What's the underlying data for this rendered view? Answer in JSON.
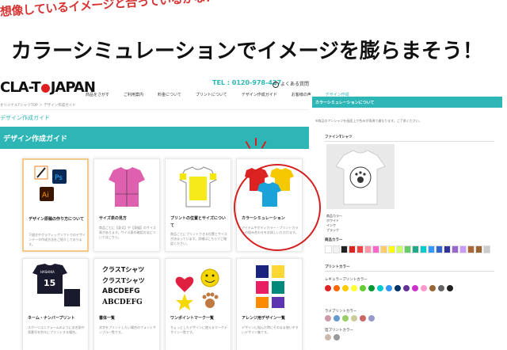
{
  "caption": {
    "sub": "想像しているイメージと合っているかな？",
    "headline": "カラーシミュレーションでイメージを膨らまそう！"
  },
  "header": {
    "logo_left": "CLA-T",
    "logo_right": "JAPAN",
    "tel": "TEL : 0120-978-427",
    "faq": "よくある質問",
    "nav": [
      "商品をさがす",
      "ご利用案内",
      "料金について",
      "プリントについて",
      "デザイン作成ガイド",
      "お客様の声",
      "デザイン作成"
    ]
  },
  "breadcrumb": "オリジナルTシャツTOP ＞ デザイン作成ガイド",
  "page_title": "デザイン作成ガイド",
  "banner_title": "デザイン作成ガイド",
  "cards": [
    {
      "title": "デザイン原稿の作り方について",
      "desc": "下描きやグラフィックソフトでのデザインデータ作成方法をご紹介しております。"
    },
    {
      "title": "サイズ表の見方",
      "desc": "商品ごとに【身丈】や【身幅】のサイズ表があります。サイズ表の確認方法についてはこちら。"
    },
    {
      "title": "プリントの位置とサイズについて",
      "desc": "商品ごとにプリントできる位置とサイズが決まっています。詳細はこちらでご確認ください。"
    },
    {
      "title": "カラーシミュレーション",
      "desc": "アイテムやボディカラー・プリントカラーの組み合わせをお試しいただけます。"
    },
    {
      "title": "ネーム・ナンバープリント",
      "desc": "スポーツユニフォームのようにお名前や背番号を別々にプリントする場合。"
    },
    {
      "title": "書体一覧",
      "desc": "文字をプリントしたい場合のフォントサンプル一覧です。"
    },
    {
      "title": "ワンポイントマーク一覧",
      "desc": "ちょっとしたデザインに使えるマークデザイン一覧です。"
    },
    {
      "title": "アレンジ用デザイン一覧",
      "desc": "デザインに悩んだ時にそのまま使いやすいデザイン集です。"
    }
  ],
  "font_sample": {
    "line1": "クラスTシャツ",
    "line2": "クラスTシャツ",
    "line3": "ABCDEFG",
    "line4": "ABCDEFG"
  },
  "uniform": {
    "name": "HASHIKA",
    "number": "15"
  },
  "side": {
    "head": "カラーシミュレーションについて",
    "note": "※商品のアンシャツを画面上で色みが再現で違なります。ご了承ください。",
    "product": "ファインTシャツ",
    "spec_label": "商品カラー",
    "spec_body": "ホワイト",
    "spec_ink_label": "インク",
    "spec_ink": "ブラック",
    "body_color_label": "商品カラー",
    "print_color_label": "プリントカラー",
    "regular_label": "レギュラープリントカラー",
    "special_label": "ラメプリントカラー",
    "foil_label": "箔プリントカラー"
  },
  "colors": {
    "accent": "#2eb5b5",
    "highlight": "#d62020",
    "body_swatches": [
      "#ffffff",
      "#f2f2f2",
      "#222222",
      "#d22",
      "#e44",
      "#f9a",
      "#f6c",
      "#fc6",
      "#ff0",
      "#cf6",
      "#6c6",
      "#2a8",
      "#0cc",
      "#39f",
      "#36c",
      "#339",
      "#96c",
      "#c9f",
      "#a63",
      "#963",
      "#ccc",
      "#999",
      "#666",
      "#ffd",
      "#fff",
      "#eee",
      "#ddf",
      "#fee",
      "#efe",
      "#ddd"
    ],
    "regular_dots": [
      "#d22",
      "#f60",
      "#fc0",
      "#ff3",
      "#6c3",
      "#093",
      "#0cc",
      "#39f",
      "#036",
      "#639",
      "#c3c",
      "#f9c",
      "#963",
      "#666",
      "#222",
      "#fff"
    ],
    "special_dots": [
      "#c9a",
      "#69c",
      "#9c6",
      "#cc9",
      "#c66",
      "#99c"
    ],
    "foil_dots": [
      "#cba",
      "#999"
    ]
  }
}
